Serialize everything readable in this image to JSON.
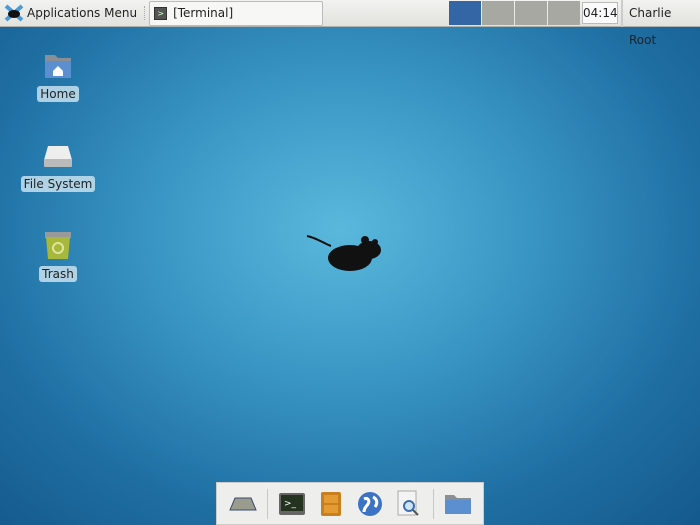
{
  "panel": {
    "app_menu_label": "Applications Menu",
    "task_label": "[Terminal]",
    "workspaces": [
      {
        "active": true
      },
      {
        "active": false
      },
      {
        "active": false
      },
      {
        "active": false
      }
    ],
    "clock": "04:14",
    "user": "Charlie Root"
  },
  "desktop": {
    "icons": [
      {
        "label": "Home",
        "icon": "home-folder-icon"
      },
      {
        "label": "File System",
        "icon": "drive-icon"
      },
      {
        "label": "Trash",
        "icon": "trash-icon"
      }
    ]
  },
  "dock": {
    "items": [
      "show-desktop-icon",
      "terminal-icon",
      "file-cabinet-icon",
      "web-browser-icon",
      "search-icon",
      "folder-icon"
    ]
  },
  "colors": {
    "accent": "#3465a4",
    "desktop": "#2d87ba"
  }
}
